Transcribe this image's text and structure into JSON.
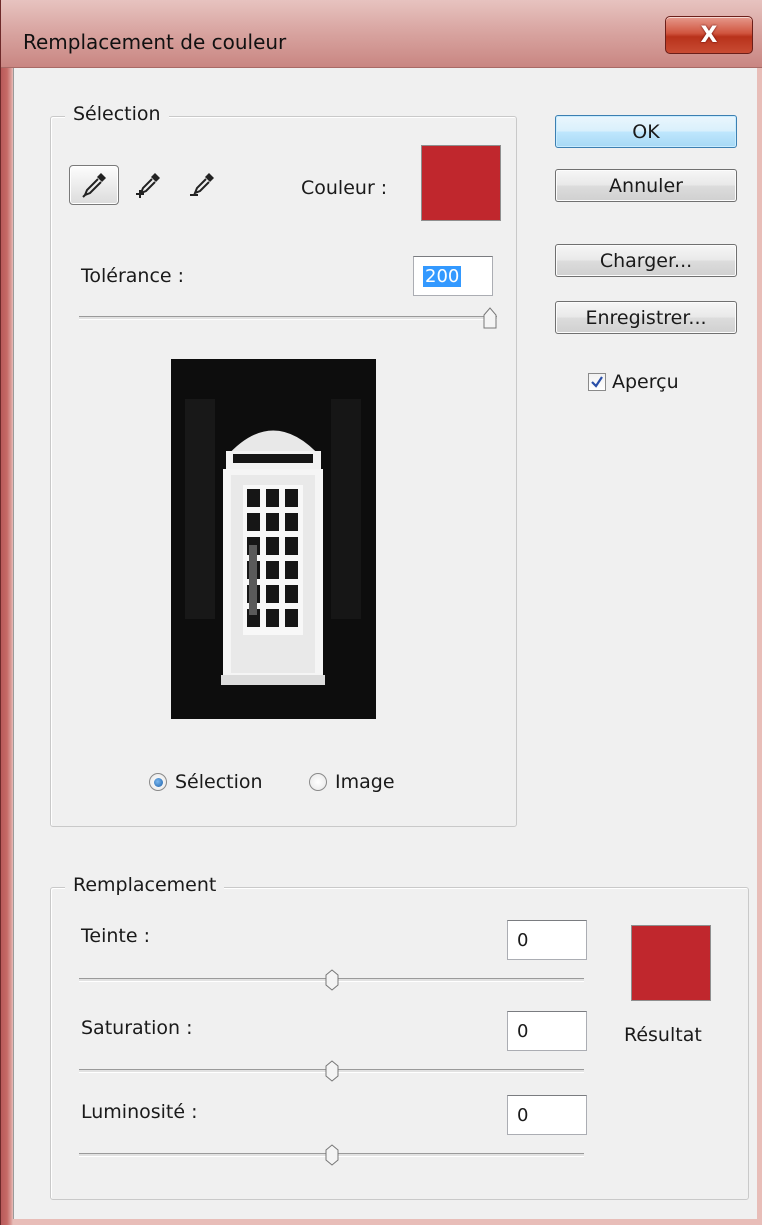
{
  "window": {
    "title": "Remplacement de couleur",
    "close_glyph": "X"
  },
  "selection_group": {
    "legend": "Sélection",
    "tools": [
      {
        "icon": "eyedropper-icon",
        "active": true
      },
      {
        "icon": "eyedropper-plus-icon",
        "active": false
      },
      {
        "icon": "eyedropper-minus-icon",
        "active": false
      }
    ],
    "color_label": "Couleur :",
    "color_value": "#c0272d",
    "tolerance_label": "Tolérance :",
    "tolerance_value": "200",
    "tolerance_fraction": 1.0,
    "mode_options": [
      {
        "label": "Sélection",
        "selected": true
      },
      {
        "label": "Image",
        "selected": false
      }
    ]
  },
  "buttons": {
    "ok": "OK",
    "cancel": "Annuler",
    "load": "Charger...",
    "save": "Enregistrer..."
  },
  "preview_checkbox": {
    "label": "Aperçu",
    "checked": true
  },
  "replacement_group": {
    "legend": "Remplacement",
    "hue_label": "Teinte :",
    "hue_value": "0",
    "saturation_label": "Saturation :",
    "saturation_value": "0",
    "lightness_label": "Luminosité :",
    "lightness_value": "0",
    "result_label": "Résultat",
    "result_color": "#c0272d"
  }
}
